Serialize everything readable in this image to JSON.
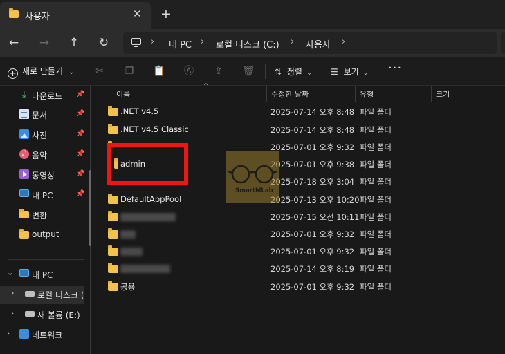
{
  "tab": {
    "title": "사용자",
    "close": "✕",
    "new": "+"
  },
  "nav": {
    "back": "←",
    "forward": "→",
    "up": "↑",
    "refresh": "↻",
    "sep": "›",
    "breadcrumbs": [
      "내 PC",
      "로컬 디스크 (C:)",
      "사용자"
    ]
  },
  "toolbar": {
    "new_label": "새로 만들기",
    "new_caret": "⌄",
    "sort_label": "정렬",
    "view_label": "보기",
    "caret": "⌄",
    "more": "···"
  },
  "sidebar": {
    "pin": "📌",
    "expanded": "⌄",
    "collapsed": "›",
    "quick_access": [
      {
        "label": "다운로드",
        "icon": "download-icon"
      },
      {
        "label": "문서",
        "icon": "document-icon"
      },
      {
        "label": "사진",
        "icon": "pictures-icon"
      },
      {
        "label": "음악",
        "icon": "music-icon"
      },
      {
        "label": "동영상",
        "icon": "video-icon"
      },
      {
        "label": "내 PC",
        "icon": "pc-icon"
      }
    ],
    "folders": [
      {
        "label": "변환",
        "icon": "folder-icon"
      },
      {
        "label": "output",
        "icon": "folder-icon"
      }
    ],
    "tree": [
      {
        "label": "내 PC",
        "icon": "pc-icon"
      },
      {
        "label": "로컬 디스크 (C:)",
        "icon": "drive-icon"
      },
      {
        "label": "새 볼륨 (E:)",
        "icon": "drive-icon"
      },
      {
        "label": "네트워크",
        "icon": "network-icon"
      }
    ]
  },
  "columns": {
    "name": "이름",
    "modified": "수정한 날짜",
    "type": "유형",
    "size": "크기"
  },
  "files": [
    {
      "name": ".NET v4.5",
      "modified": "2025-07-14 오후 8:48",
      "type": "파일 폴더"
    },
    {
      "name": ".NET v4.5 Classic",
      "modified": "2025-07-14 오후 8:48",
      "type": "파일 폴더"
    },
    {
      "name": "",
      "modified": "2025-07-01 오후 9:32",
      "type": "파일 폴더"
    },
    {
      "name": "admin",
      "modified": "2025-07-01 오후 9:38",
      "type": "파일 폴더"
    },
    {
      "name": "",
      "modified": "2025-07-18 오후 3:04",
      "type": "파일 폴더"
    },
    {
      "name": "DefaultAppPool",
      "modified": "2025-07-13 오후 10:20",
      "type": "파일 폴더"
    },
    {
      "name": "",
      "modified": "2025-07-15 오전 10:11",
      "type": "파일 폴더"
    },
    {
      "name": "",
      "modified": "2025-07-01 오후 9:32",
      "type": "파일 폴더"
    },
    {
      "name": "",
      "modified": "2025-07-01 오후 9:32",
      "type": "파일 폴더"
    },
    {
      "name": "",
      "modified": "2025-07-14 오후 8:19",
      "type": "파일 폴더"
    },
    {
      "name": "공용",
      "modified": "2025-07-01 오후 9:32",
      "type": "파일 폴더"
    }
  ],
  "watermark": {
    "text": "SmartMLab"
  },
  "colors": {
    "folder": "#f3c24a",
    "highlight_box": "#f01414",
    "background": "#191919"
  }
}
